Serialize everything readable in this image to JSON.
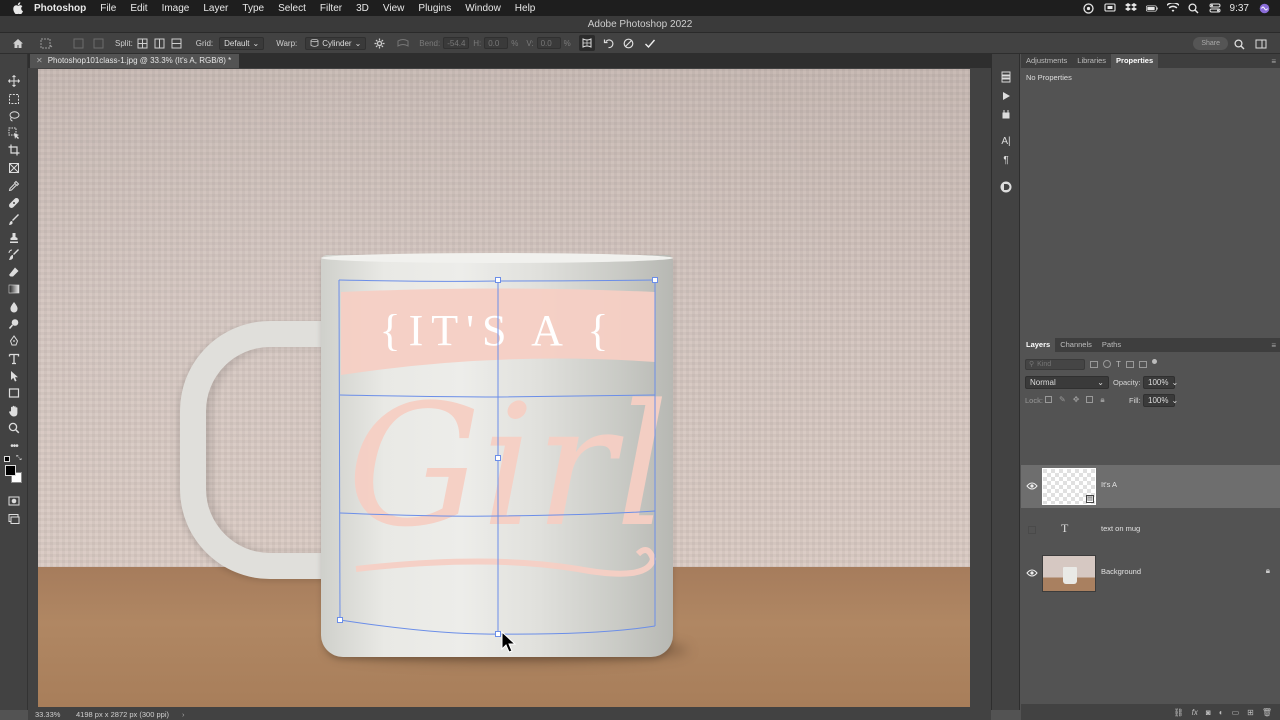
{
  "menubar": {
    "items": [
      "Photoshop",
      "File",
      "Edit",
      "Image",
      "Layer",
      "Type",
      "Select",
      "Filter",
      "3D",
      "View",
      "Plugins",
      "Window",
      "Help"
    ],
    "clock": "9:37"
  },
  "window": {
    "title": "Adobe Photoshop 2022"
  },
  "options_bar": {
    "split_label": "Split:",
    "grid_label": "Grid:",
    "grid_value": "Default",
    "warp_label": "Warp:",
    "warp_value": "Cylinder",
    "bend_label": "Bend:",
    "bend_value": "-54.4",
    "h_label": "H:",
    "h_value": "0.0",
    "h_unit": "%",
    "v_label": "V:",
    "v_value": "0.0",
    "v_unit": "%",
    "share_label": "Share"
  },
  "document": {
    "tab_title": "Photoshop101class-1.jpg @ 33.3% (It's A, RGB/8) *",
    "mug_text_top": "{IT'S A {",
    "mug_text_main": "Girl"
  },
  "properties_panel": {
    "tabs": [
      "Adjustments",
      "Libraries",
      "Properties"
    ],
    "active_tab": "Properties",
    "message": "No Properties"
  },
  "layers_panel": {
    "tabs": [
      "Layers",
      "Channels",
      "Paths"
    ],
    "active_tab": "Layers",
    "filter_placeholder": "Kind",
    "blend_mode": "Normal",
    "opacity_label": "Opacity:",
    "opacity_value": "100%",
    "lock_label": "Lock:",
    "fill_label": "Fill:",
    "fill_value": "100%",
    "layers": [
      {
        "name": "It's A",
        "visible": true,
        "selected": true,
        "kind": "smart-object"
      },
      {
        "name": "text on mug",
        "visible": false,
        "selected": false,
        "kind": "type"
      },
      {
        "name": "Background",
        "visible": true,
        "selected": false,
        "kind": "image",
        "locked": true
      }
    ]
  },
  "status_bar": {
    "zoom": "33.33%",
    "doc_info": "4198 px x 2872 px (300 ppi)"
  },
  "colors": {
    "accent": "#4a90e2",
    "warp_grid": "#6b8ee8",
    "mug_print": "#f6cfc4"
  }
}
